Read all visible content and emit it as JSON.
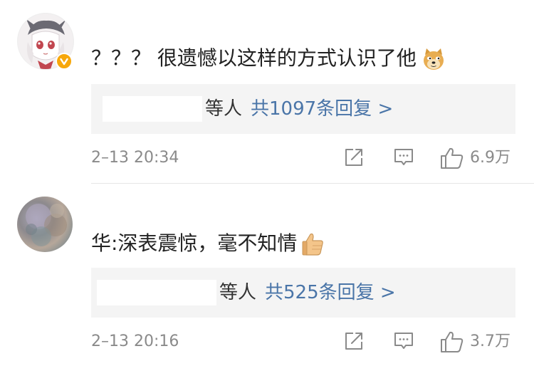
{
  "comments": [
    {
      "text": "？？？ 很遗憾以这样的方式认识了他",
      "emoji": "doge-emoji",
      "reply_suffix": "等人",
      "reply_link": "共1097条回复 >",
      "timestamp": "2–13 20:34",
      "likes": "6.9万",
      "verified": true
    },
    {
      "text": "华:深表震惊，毫不知情",
      "emoji": "thumbs-up-emoji",
      "reply_suffix": "等人",
      "reply_link": "共525条回复 >",
      "timestamp": "2–13 20:16",
      "likes": "3.7万",
      "verified": false
    }
  ],
  "colors": {
    "link": "#4a75a8",
    "meta_text": "#8a8a8a",
    "reply_box_bg": "#f4f4f4",
    "badge": "#f7a70a"
  }
}
